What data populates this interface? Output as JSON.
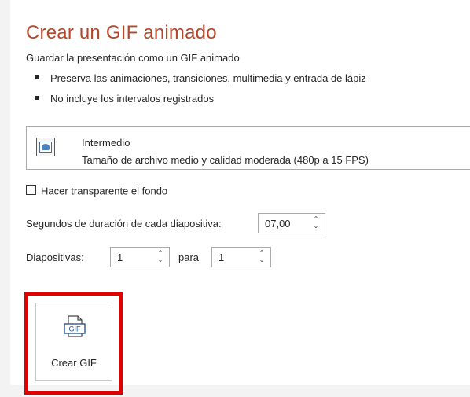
{
  "header": {
    "title": "Crear un GIF animado",
    "subtitle": "Guardar la presentación como un GIF animado",
    "bullets": [
      "Preserva las animaciones, transiciones, multimedia y entrada de lápiz",
      "No incluye los intervalos registrados"
    ]
  },
  "quality": {
    "name": "Intermedio",
    "description": "Tamaño de archivo medio y calidad moderada (480p a 15 FPS)",
    "icon": "presentation-icon"
  },
  "transparent": {
    "label": "Hacer transparente el fondo",
    "checked": false
  },
  "duration": {
    "label": "Segundos de duración de cada diapositiva:",
    "value": "07,00"
  },
  "slides": {
    "label": "Diapositivas:",
    "from": "1",
    "to_label": "para",
    "to": "1"
  },
  "create": {
    "label": "Crear GIF",
    "icon": "gif-file-icon",
    "icon_text": "GIF"
  },
  "colors": {
    "title": "#b7472a",
    "highlight": "#e00000",
    "icon_blue": "#2b579a"
  }
}
